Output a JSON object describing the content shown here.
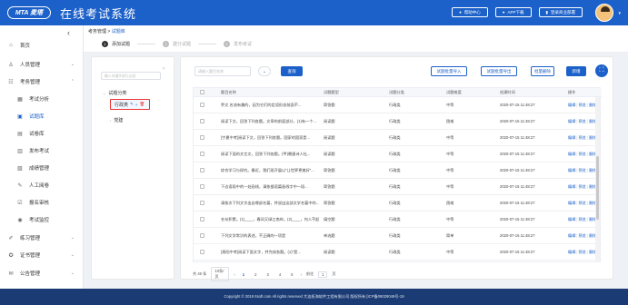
{
  "header": {
    "logo": "MTA 麦塔",
    "title": "在线考试系统",
    "buttons": [
      {
        "label": "帮助中心",
        "icon": "help-icon"
      },
      {
        "label": "APP下载",
        "icon": "download-icon"
      },
      {
        "label": "登录商业部署",
        "icon": "deploy-icon"
      }
    ],
    "caret": "▾"
  },
  "sidebar": {
    "collapse": "‹",
    "items": [
      {
        "label": "首页",
        "icon": "⌂",
        "caret": ""
      },
      {
        "label": "人员管理",
        "icon": "♙",
        "caret": "⌄"
      },
      {
        "label": "考务管理",
        "icon": "☷",
        "caret": "⌃"
      },
      {
        "label": "考试分析",
        "icon": "▦",
        "caret": ""
      },
      {
        "label": "试题库",
        "icon": "▣",
        "caret": ""
      },
      {
        "label": "试卷库",
        "icon": "▤",
        "caret": ""
      },
      {
        "label": "发布考试",
        "icon": "▥",
        "caret": ""
      },
      {
        "label": "成绩管理",
        "icon": "▧",
        "caret": ""
      },
      {
        "label": "人工阅卷",
        "icon": "✎",
        "caret": ""
      },
      {
        "label": "报名审核",
        "icon": "☑",
        "caret": ""
      },
      {
        "label": "考试监控",
        "icon": "◉",
        "caret": ""
      },
      {
        "label": "练习管理",
        "icon": "✐",
        "caret": "⌄"
      },
      {
        "label": "证书管理",
        "icon": "✪",
        "caret": "⌄"
      },
      {
        "label": "公告管理",
        "icon": "✉",
        "caret": "⌄"
      }
    ]
  },
  "breadcrumb": {
    "root": "考务管理",
    "sep": " > ",
    "current": "试题库"
  },
  "steps": [
    {
      "num": "1",
      "label": "添加试题"
    },
    {
      "num": "2",
      "label": "建分试题"
    },
    {
      "num": "3",
      "label": "发布考试"
    }
  ],
  "tree": {
    "search_placeholder": "输入关键字进行过滤",
    "arrow": "›",
    "root": "试题分类",
    "selected": "行政类",
    "sibling": "党建",
    "caret_open": "⌄",
    "caret_closed": "›",
    "icon_edit": "✎",
    "icon_add": "+",
    "icon_delete": "🗑"
  },
  "toolbar": {
    "search_placeholder": "请输入题目名称",
    "circle": "⌄",
    "search_label": "查询",
    "import_label": "试题批量导入",
    "export_label": "试题批量导出",
    "batch_delete_label": "批量删除",
    "add_label": "新增",
    "fullscreen": "⛶"
  },
  "table": {
    "headers": [
      "题目名称",
      "试题题型",
      "试题分类",
      "试题难度",
      "创建时间",
      "操作"
    ],
    "op_labels": [
      "编辑",
      "预览",
      "删除"
    ],
    "op_sep": "|",
    "rows": [
      {
        "name": "乔文 名流有趣的，因为它们的定语形态前面不...",
        "type": "简答题",
        "cat": "行政类",
        "diff": "中等",
        "time": "2020-07-15 11:48:27"
      },
      {
        "name": "阅读下文，回答下列各题。文章的前面部分，(1)有一个...",
        "type": "阅读题",
        "cat": "行政类",
        "diff": "困难",
        "time": "2020-07-15 11:48:27"
      },
      {
        "name": "[宁夏中考]阅读下文，回答下列各题。国家的国家是...",
        "type": "阅读题",
        "cat": "行政类",
        "diff": "中等",
        "time": "2020-07-15 11:48:27"
      },
      {
        "name": "阅读下面的文言文，回答下列各题。(甲)晚唐诗人杜...",
        "type": "阅读题",
        "cat": "行政类",
        "diff": "中等",
        "time": "2020-07-15 11:48:27"
      },
      {
        "name": "综合学习与探究。最近，我们班开展以\"让世界更美好\"...",
        "type": "简答题",
        "cat": "行政类",
        "diff": "中等",
        "time": "2020-07-15 11:48:27"
      },
      {
        "name": "下边语段中的一处画线，请依据语篇画线字中一段...",
        "type": "简答题",
        "cat": "行政类",
        "diff": "中等",
        "time": "2020-07-15 11:48:27"
      },
      {
        "name": "请依次下列文字出自哪部名著，并说出这部文学名著中的...",
        "type": "简答题",
        "cat": "行政类",
        "diff": "困难",
        "time": "2020-07-15 11:48:27"
      },
      {
        "name": "名句积累。(1)____，春风又绿江南岸。(2)____，何人不起...",
        "type": "填空题",
        "cat": "行政类",
        "diff": "中等",
        "time": "2020-07-15 11:48:27"
      },
      {
        "name": "下列文学常识的表述，不正确的一项是",
        "type": "单选题",
        "cat": "行政类",
        "diff": "简单",
        "time": "2020-07-15 11:48:27"
      },
      {
        "name": "[贵阳中考]阅读下面文字，并完成各题。(1)\"是...",
        "type": "阅读题",
        "cat": "行政类",
        "diff": "中等",
        "time": "2020-07-15 11:48:27"
      }
    ]
  },
  "pager": {
    "total": "共 45 条",
    "size": "10条/页",
    "prev": "‹",
    "pages": [
      "1",
      "2",
      "3",
      "4",
      "5"
    ],
    "next": "›",
    "goto": "前往",
    "page_input": "1",
    "page_unit": "页"
  },
  "footer": {
    "text": "Copyright © 2019 Itsoft.com All rights reserved 大连枢海软件工程有限公司 版权所有 [ICP备09029049号-19"
  }
}
